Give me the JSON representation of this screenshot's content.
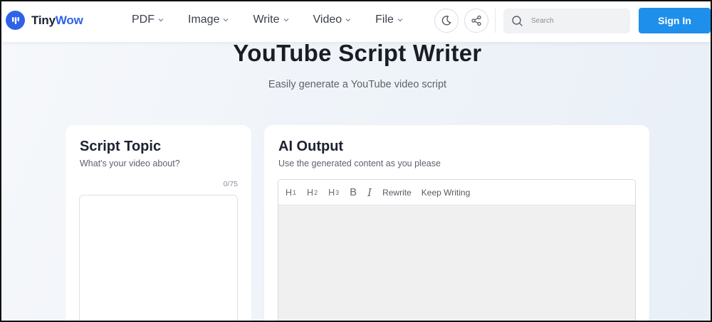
{
  "brand": {
    "name_part1": "Tiny",
    "name_part2": "Wow"
  },
  "nav": [
    {
      "label": "PDF"
    },
    {
      "label": "Image"
    },
    {
      "label": "Write"
    },
    {
      "label": "Video"
    },
    {
      "label": "File"
    }
  ],
  "header": {
    "search_placeholder": "Search",
    "signin_label": "Sign In",
    "icons": [
      "moon-icon",
      "share-icon",
      "search-icon"
    ]
  },
  "hero": {
    "title": "YouTube Script Writer",
    "subtitle": "Easily generate a YouTube video script"
  },
  "topic_card": {
    "title": "Script Topic",
    "subtitle": "What's your video about?",
    "counter": "0/75",
    "input_value": ""
  },
  "output_card": {
    "title": "AI Output",
    "subtitle": "Use the generated content as you please",
    "toolbar": {
      "h1": "H",
      "h1_sub": "1",
      "h2": "H",
      "h2_sub": "2",
      "h3": "H",
      "h3_sub": "3",
      "bold": "B",
      "italic": "I",
      "rewrite": "Rewrite",
      "keep_writing": "Keep Writing"
    }
  },
  "colors": {
    "accent": "#2f62e6",
    "signin": "#1f8fec",
    "editor_bg": "#f0f0f0"
  }
}
